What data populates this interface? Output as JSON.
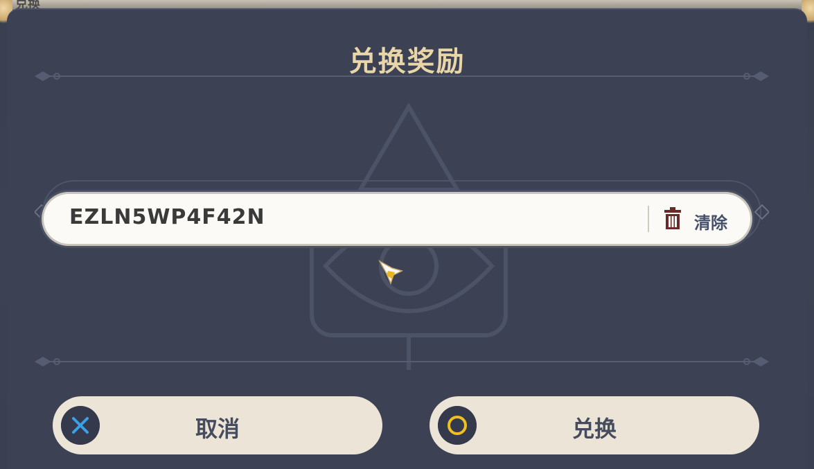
{
  "underlying_screen": {
    "peek_text": "兑换"
  },
  "dialog": {
    "title": "兑换奖励",
    "code_input": {
      "value": "EZLN5WP4F42N"
    },
    "clear_label": "清除",
    "cancel_button": {
      "label": "取消",
      "icon": "cross-icon"
    },
    "confirm_button": {
      "label": "兑换",
      "icon": "circle-icon"
    }
  },
  "colors": {
    "dialog_bg": "#3c4254",
    "title": "#e9d6a8",
    "button_bg": "#ece4d6",
    "button_text": "#454c5e",
    "cross_icon": "#3aa0e8",
    "circle_icon": "#f0c020",
    "trash_icon": "#6a2a2a"
  }
}
